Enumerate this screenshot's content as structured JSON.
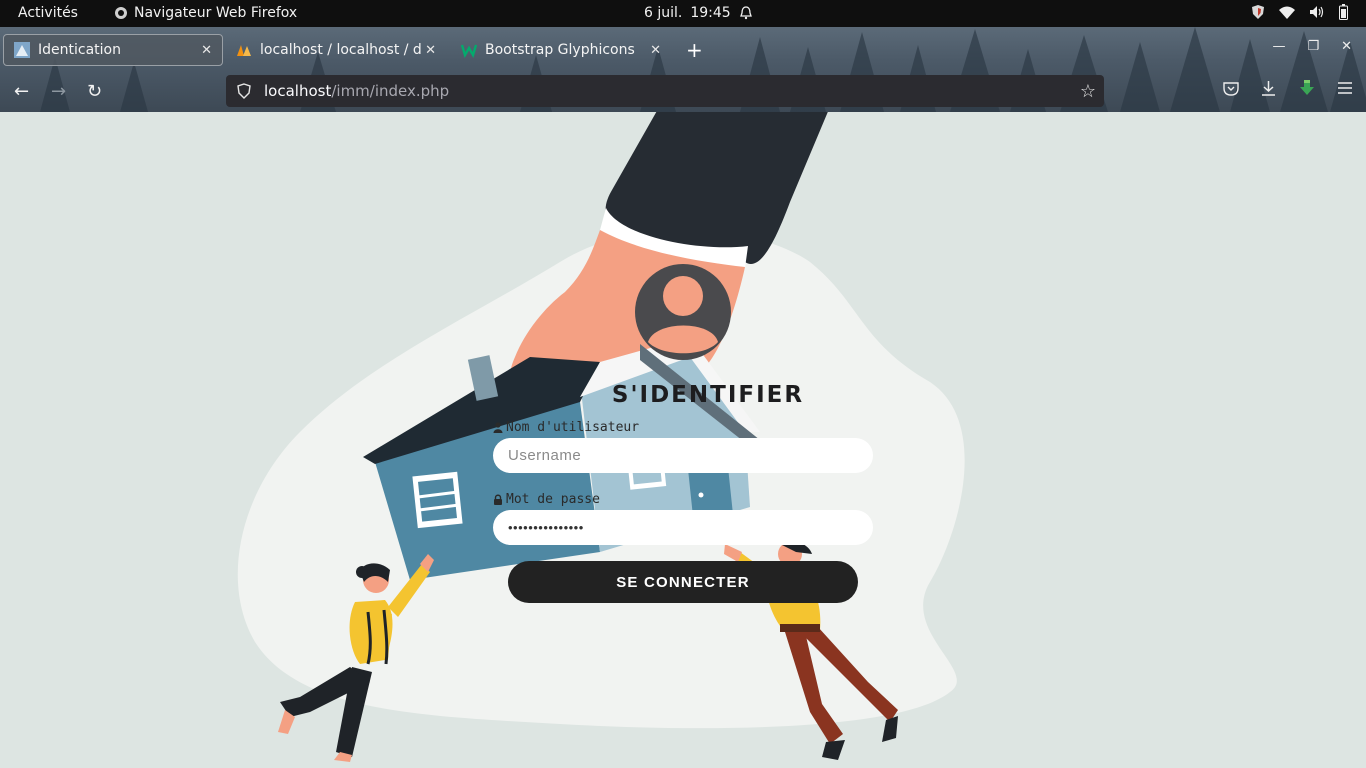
{
  "topbar": {
    "activities": "Activités",
    "app_name": "Navigateur Web Firefox",
    "date": "6 juil.",
    "time": "19:45"
  },
  "browser": {
    "tabs": [
      {
        "label": "Identication",
        "active": true
      },
      {
        "label": "localhost / localhost / db",
        "active": false
      },
      {
        "label": "Bootstrap Glyphicons",
        "active": false
      }
    ],
    "url_host": "localhost",
    "url_path": "/imm/index.php"
  },
  "login": {
    "title": "S'IDENTIFIER",
    "username_label": "Nom d'utilisateur",
    "username_placeholder": "Username",
    "password_label": "Mot de passe",
    "password_value": "•••••••••••••••",
    "submit_label": "SE CONNECTER"
  },
  "colors": {
    "page_bg": "#dde5e2",
    "button_bg": "#222222",
    "hand_skin": "#f4a083",
    "house_blue": "#4f88a3",
    "roof": "#1f2a33",
    "sleeve": "#262c33"
  }
}
